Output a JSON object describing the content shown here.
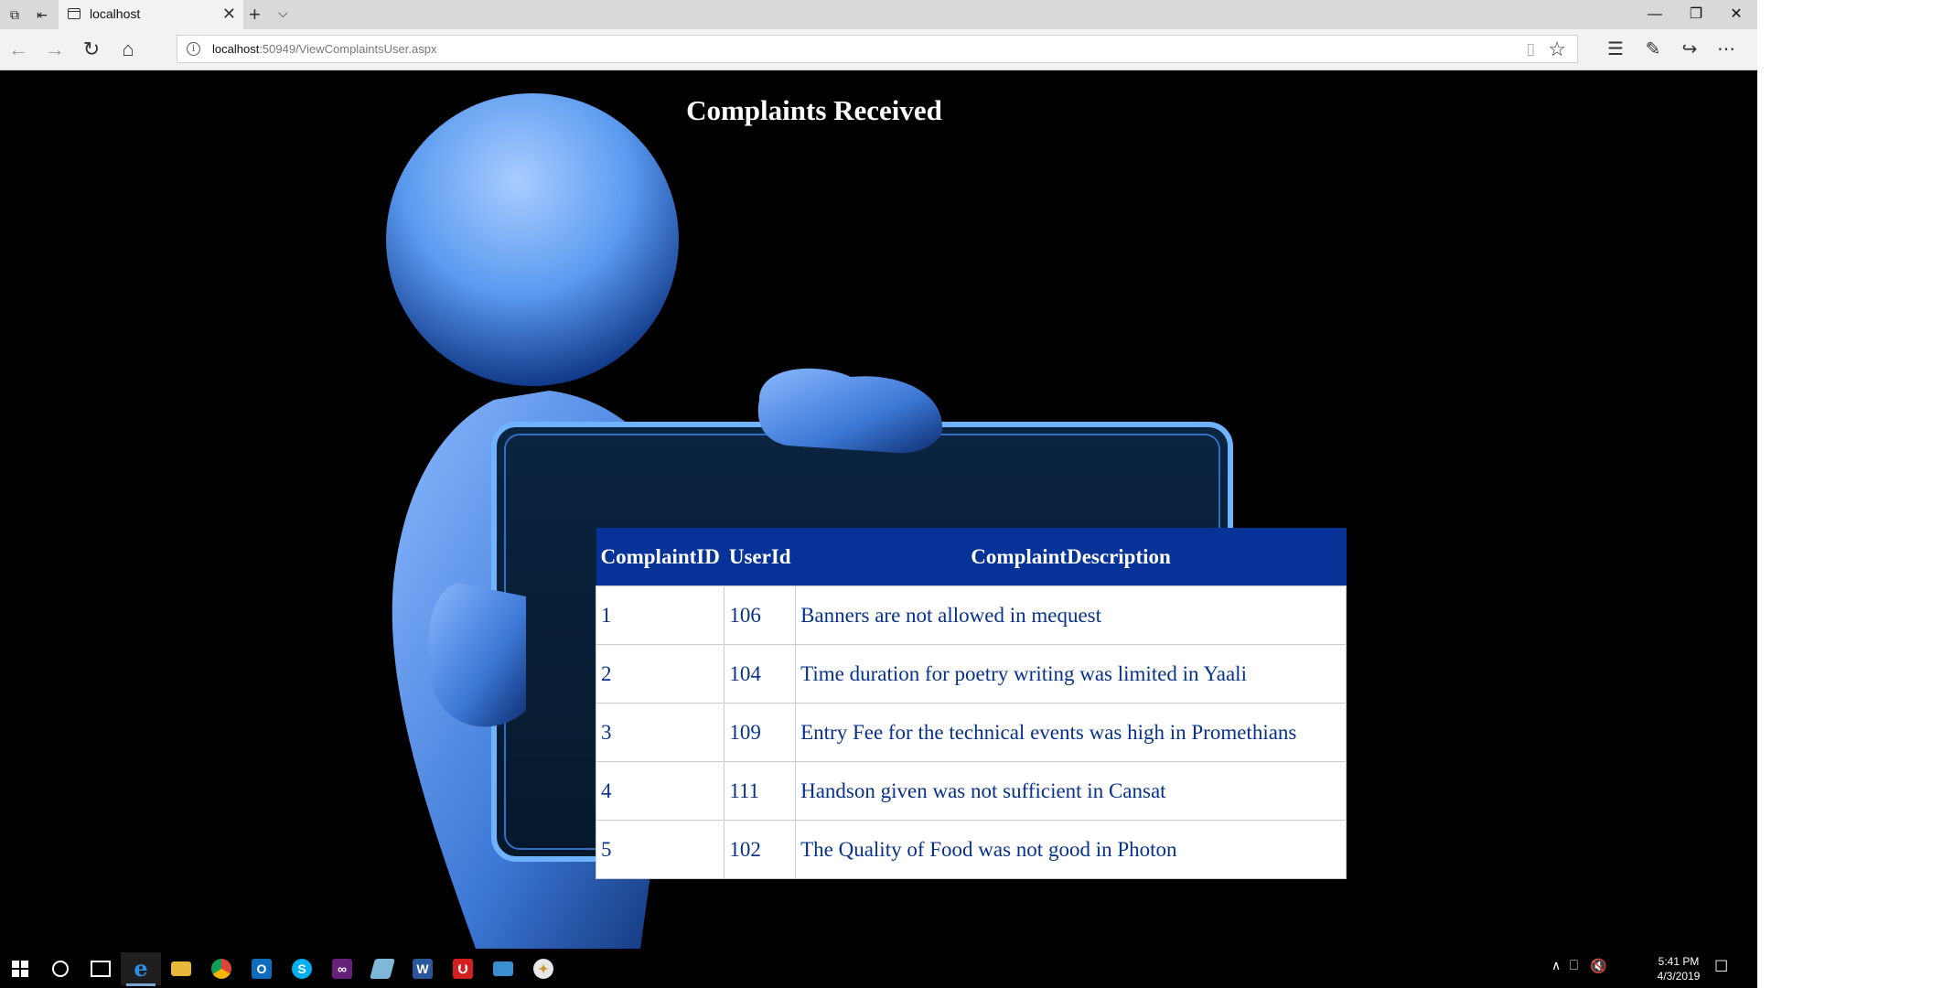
{
  "browser": {
    "tab_title": "localhost",
    "url_host": "localhost",
    "url_rest": ":50949/ViewComplaintsUser.aspx"
  },
  "page": {
    "title": "Complaints Received",
    "table": {
      "headers": [
        "ComplaintID",
        "UserId",
        "ComplaintDescription"
      ],
      "rows": [
        [
          "1",
          "106",
          "Banners are not allowed in mequest"
        ],
        [
          "2",
          "104",
          "Time duration for poetry writing was limited in Yaali"
        ],
        [
          "3",
          "109",
          "Entry Fee for the technical events was high in Promethians"
        ],
        [
          "4",
          "111",
          "Handson given was not sufficient in Cansat"
        ],
        [
          "5",
          "102",
          "The Quality of Food was not good in Photon"
        ]
      ]
    }
  },
  "taskbar": {
    "time": "5:41 PM",
    "date": "4/3/2019"
  },
  "colors": {
    "table_header": "#073399",
    "table_text": "#07318a",
    "figure_blue": "#5b9bf0"
  }
}
